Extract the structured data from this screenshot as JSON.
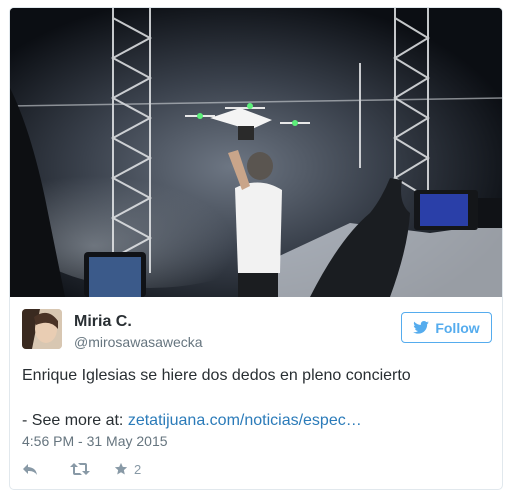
{
  "tweet": {
    "author": {
      "name": "Miria C.",
      "handle": "@mirosawasawecka"
    },
    "follow_label": "Follow",
    "text": "Enrique Iglesias se hiere dos dedos en pleno concierto",
    "more_prefix": "- See more at: ",
    "more_link": "zetatijuana.com/noticias/espec…",
    "timestamp": "4:56 PM - 31 May 2015",
    "favorites_count": "2"
  },
  "icons": {
    "follow": "twitter-bird-icon",
    "reply": "reply-icon",
    "retweet": "retweet-icon",
    "favorite": "star-icon"
  },
  "colors": {
    "accent": "#55acee",
    "link": "#2b7bb9",
    "secondary_text": "#66757f",
    "action_icons": "#8899a6",
    "border": "#e1e8ed"
  }
}
